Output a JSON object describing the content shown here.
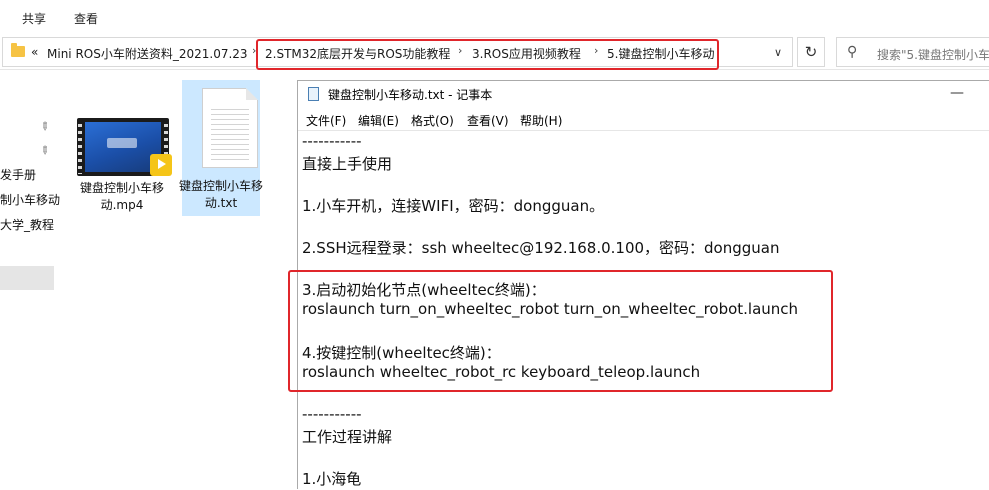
{
  "ribbon": {
    "tabs": [
      "共享",
      "查看"
    ]
  },
  "address": {
    "prefix": "«",
    "crumbs": [
      "Mini ROS小车附送资料_2021.07.23",
      "2.STM32底层开发与ROS功能教程",
      "3.ROS应用视频教程",
      "5.键盘控制小车移动"
    ],
    "separator": "›",
    "dropdown_icon": "∨",
    "refresh_icon": "↻"
  },
  "search": {
    "icon": "⚲",
    "placeholder": "搜索\"5.键盘控制小车"
  },
  "nav": {
    "pin_icon": "📌",
    "items": [
      "发手册",
      "制小车移动",
      "大学_教程"
    ]
  },
  "files": [
    {
      "name_line1": "键盘控制小车移",
      "name_line2": "动.mp4",
      "type": "video"
    },
    {
      "name_line1": "键盘控制小车移",
      "name_line2": "动.txt",
      "type": "text"
    }
  ],
  "notepad": {
    "title": "键盘控制小车移动.txt - 记事本",
    "minimize_icon": "—",
    "menu": [
      "文件(F)",
      "编辑(E)",
      "格式(O)",
      "查看(V)",
      "帮助(H)"
    ],
    "lines": [
      "-----------",
      "直接上手使用",
      "",
      "1.小车开机，连接WIFI，密码：dongguan。",
      "",
      "2.SSH远程登录：ssh wheeltec@192.168.0.100，密码：dongguan",
      "",
      "3.启动初始化节点(wheeltec终端)：",
      "roslaunch turn_on_wheeltec_robot turn_on_wheeltec_robot.launch",
      "",
      "4.按键控制(wheeltec终端)：",
      "roslaunch wheeltec_robot_rc keyboard_teleop.launch",
      "",
      "-----------",
      "工作过程讲解",
      "",
      "1.小海龟"
    ]
  },
  "colors": {
    "highlight_box": "#e0262b",
    "selection": "#cce8ff"
  }
}
